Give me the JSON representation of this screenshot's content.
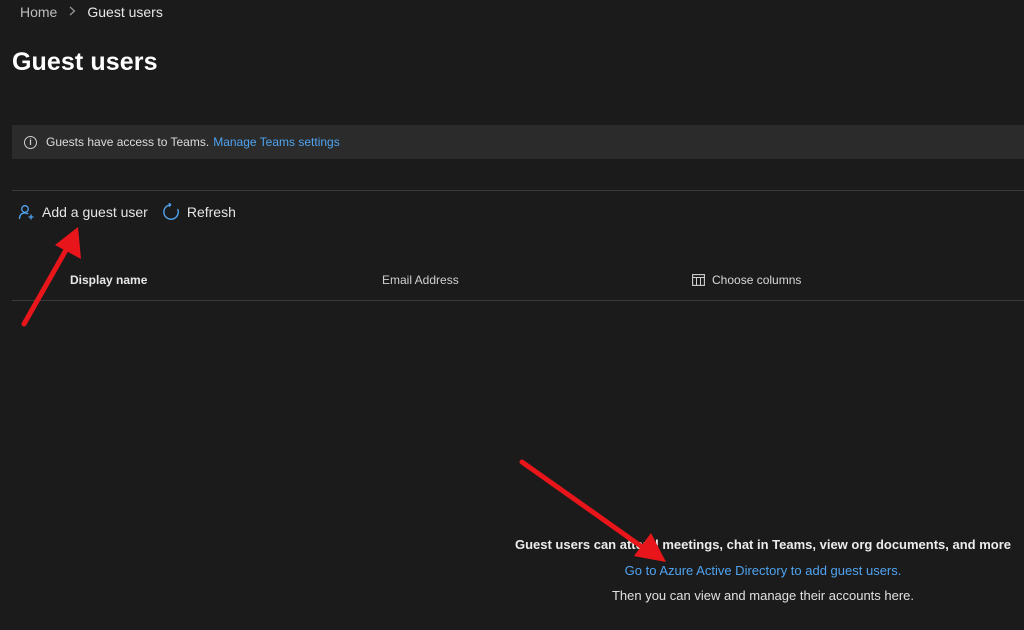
{
  "breadcrumb": {
    "home": "Home",
    "separator": ">",
    "current": "Guest users"
  },
  "page": {
    "title": "Guest users"
  },
  "info_bar": {
    "icon": "info-icon",
    "text": "Guests have access to Teams.",
    "link": "Manage Teams settings"
  },
  "toolbar": {
    "add_label": "Add a guest user",
    "add_icon": "add-person-icon",
    "refresh_label": "Refresh",
    "refresh_icon": "refresh-icon"
  },
  "table": {
    "columns": [
      "Display name",
      "Email Address"
    ],
    "choose_columns_label": "Choose columns",
    "choose_columns_icon": "columns-icon",
    "rows": []
  },
  "empty_state": {
    "message": "Guest users can attend meetings, chat in Teams, view org documents, and more",
    "link": "Go to Azure Active Directory to add guest users.",
    "sub": "Then you can view and manage their accounts here."
  },
  "annotations": {
    "arrow_color": "#e8161b"
  },
  "colors": {
    "background": "#1b1b1b",
    "info_bar_bg": "#2b2b2b",
    "link": "#4fa3f0",
    "accent_icon": "#4fa3f0"
  }
}
